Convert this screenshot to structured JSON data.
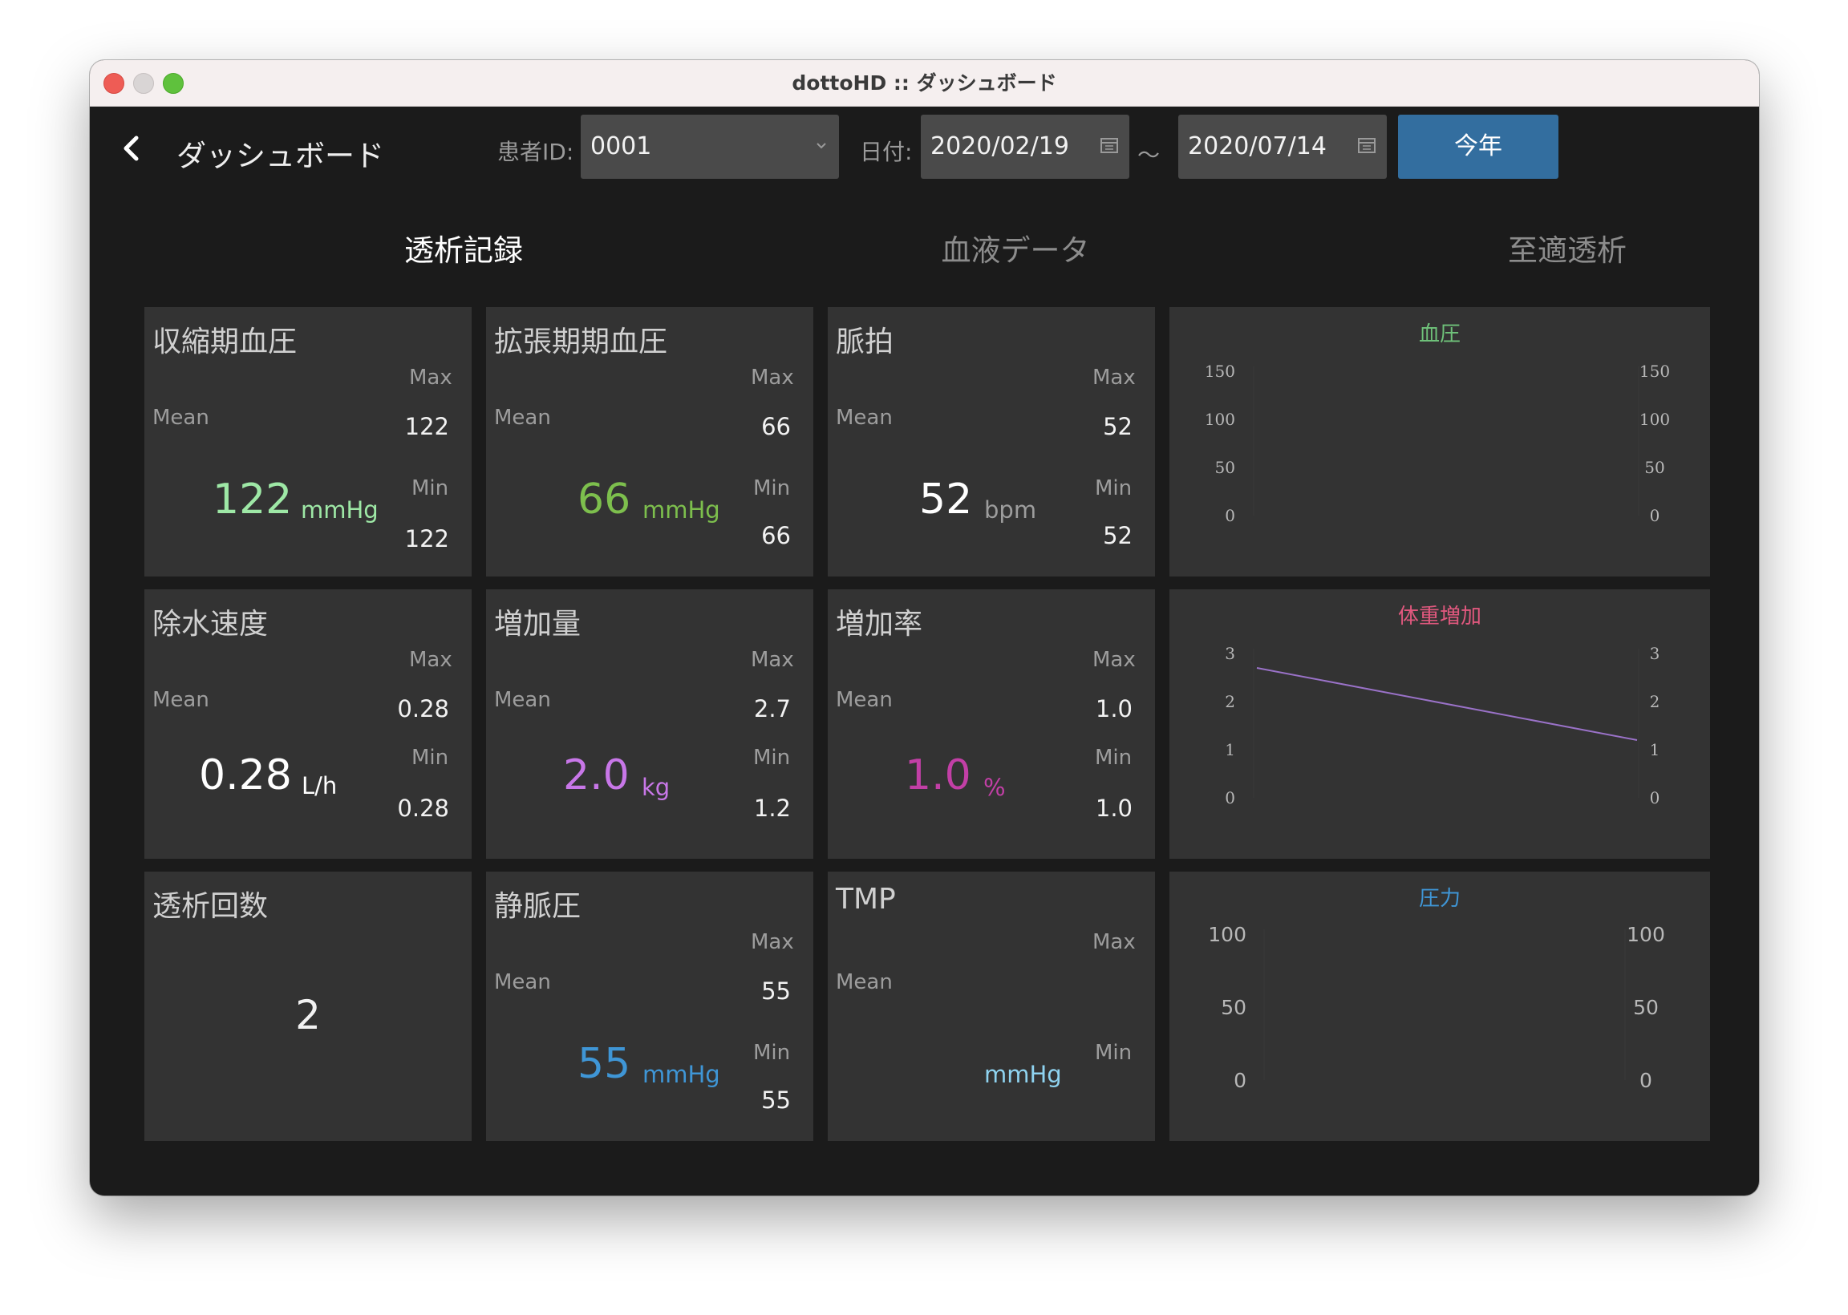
{
  "window": {
    "title": "dottoHD :: ダッシュボード"
  },
  "header": {
    "page_title": "ダッシュボード",
    "patient_label": "患者ID:",
    "patient_id": "0001",
    "date_label": "日付:",
    "date_from": "2020/02/19",
    "date_sep": "～",
    "date_to": "2020/07/14",
    "year_button": "今年"
  },
  "tabs": [
    {
      "label": "透析記録",
      "active": true
    },
    {
      "label": "血液データ",
      "active": false
    },
    {
      "label": "至適透析",
      "active": false
    }
  ],
  "labels": {
    "max": "Max",
    "min": "Min",
    "mean": "Mean"
  },
  "cards": {
    "systolic": {
      "title": "収縮期血圧",
      "mean": "122",
      "unit": "mmHg",
      "max": "122",
      "min": "122",
      "color": "#9ee8a6"
    },
    "diastolic": {
      "title": "拡張期期血圧",
      "mean": "66",
      "unit": "mmHg",
      "max": "66",
      "min": "66",
      "color": "#7dbf4d"
    },
    "pulse": {
      "title": "脈拍",
      "mean": "52",
      "unit": "bpm",
      "max": "52",
      "min": "52",
      "color": "#ffffff"
    },
    "removal_rate": {
      "title": "除水速度",
      "mean": "0.28",
      "unit": "L/h",
      "max": "0.28",
      "min": "0.28",
      "color": "#ffffff"
    },
    "gain": {
      "title": "増加量",
      "mean": "2.0",
      "unit": "kg",
      "max": "2.7",
      "min": "1.2",
      "color": "#c877e8"
    },
    "gain_rate": {
      "title": "増加率",
      "mean": "1.0",
      "unit": "%",
      "max": "1.0",
      "min": "1.0",
      "color": "#c23fa6"
    },
    "dialysis_count": {
      "title": "透析回数",
      "value": "2"
    },
    "venous": {
      "title": "静脈圧",
      "mean": "55",
      "unit": "mmHg",
      "max": "55",
      "min": "55",
      "color": "#3f96d6"
    },
    "tmp": {
      "title": "TMP",
      "mean": "",
      "unit": "mmHg",
      "max": "",
      "min": "",
      "color": "#8fd3f0"
    }
  },
  "chart_data": [
    {
      "type": "line",
      "title": "血圧",
      "title_color": "#6fc27a",
      "yticks": [
        "0",
        "50",
        "100",
        "150"
      ],
      "ylim": [
        0,
        150
      ],
      "series": []
    },
    {
      "type": "line",
      "title": "体重増加",
      "title_color": "#e0587e",
      "yticks": [
        "0",
        "1",
        "2",
        "3"
      ],
      "ylim": [
        0,
        3
      ],
      "x": [
        0,
        1
      ],
      "series": [
        {
          "values": [
            2.7,
            1.2
          ],
          "color": "#9a72c8"
        }
      ]
    },
    {
      "type": "line",
      "title": "圧力",
      "title_color": "#3f96d6",
      "yticks": [
        "0",
        "50",
        "100"
      ],
      "ylim": [
        0,
        100
      ],
      "series": []
    }
  ]
}
